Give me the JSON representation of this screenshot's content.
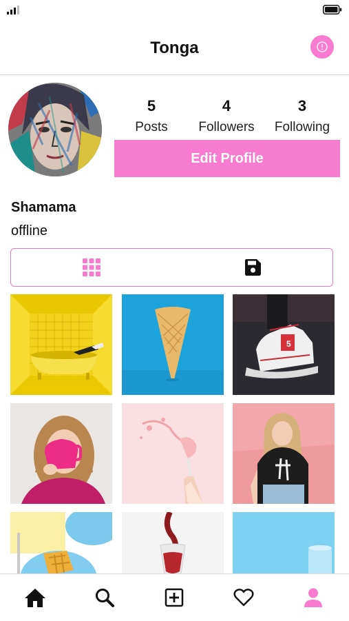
{
  "header": {
    "title": "Tonga"
  },
  "profile": {
    "username": "Shamama",
    "status": "offline",
    "stats": [
      {
        "value": "5",
        "label": "Posts"
      },
      {
        "value": "4",
        "label": "Followers"
      },
      {
        "value": "3",
        "label": "Following"
      }
    ],
    "edit_label": "Edit Profile"
  },
  "tabs": [
    {
      "icon": "grid-icon",
      "active": true
    },
    {
      "icon": "save-icon",
      "active": false
    }
  ],
  "posts": [
    {
      "subject": "yellow bathtub room"
    },
    {
      "subject": "ice cream cone"
    },
    {
      "subject": "white sneakers"
    },
    {
      "subject": "woman with pink mug"
    },
    {
      "subject": "pink drink splash"
    },
    {
      "subject": "woman on pink wall"
    },
    {
      "subject": "waffles"
    },
    {
      "subject": "wine glass"
    },
    {
      "subject": "blue cup"
    }
  ],
  "nav": [
    {
      "icon": "home-icon"
    },
    {
      "icon": "search-icon"
    },
    {
      "icon": "add-post-icon"
    },
    {
      "icon": "heart-icon"
    },
    {
      "icon": "profile-icon",
      "active": true
    }
  ],
  "colors": {
    "accent": "#f77bcf",
    "tab_border": "#e37ac7",
    "text": "#111111"
  }
}
